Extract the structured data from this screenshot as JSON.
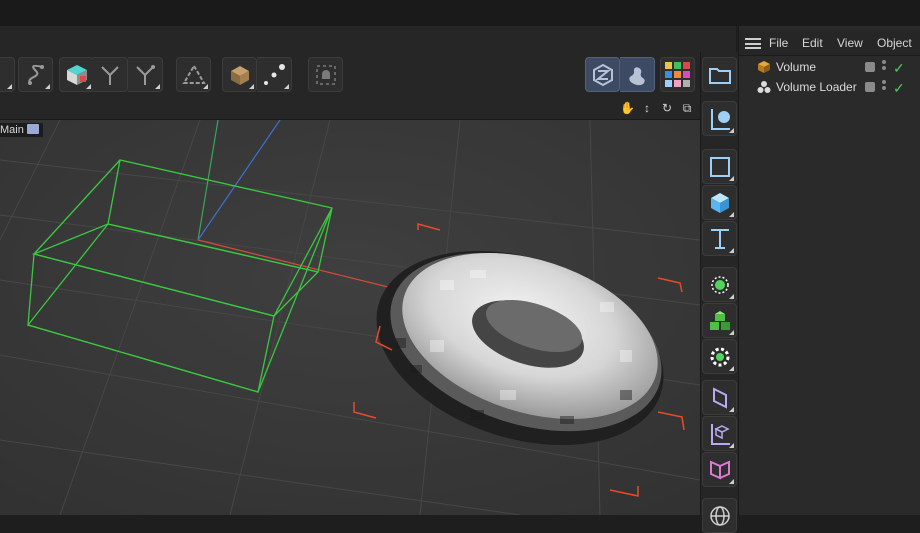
{
  "viewport": {
    "camera_label": "Main",
    "nav_icons": [
      "hand-icon",
      "move-icon",
      "rotate-icon",
      "maximize-icon"
    ]
  },
  "object_manager": {
    "menu": [
      "File",
      "Edit",
      "View",
      "Object"
    ],
    "objects": [
      {
        "name": "Volume",
        "icon": "volume-builder-icon",
        "enabled": true
      },
      {
        "name": "Volume Loader",
        "icon": "volume-loader-icon",
        "enabled": true
      }
    ]
  },
  "colors": {
    "bounding_box": "#39c840",
    "axis_x": "#d64a3a",
    "axis_y": "#36a85a",
    "axis_z": "#3f6fd0",
    "selection_corners": "#e84a2a",
    "enabled_check": "#4fc95f",
    "accent_button": "#3d4a63"
  }
}
